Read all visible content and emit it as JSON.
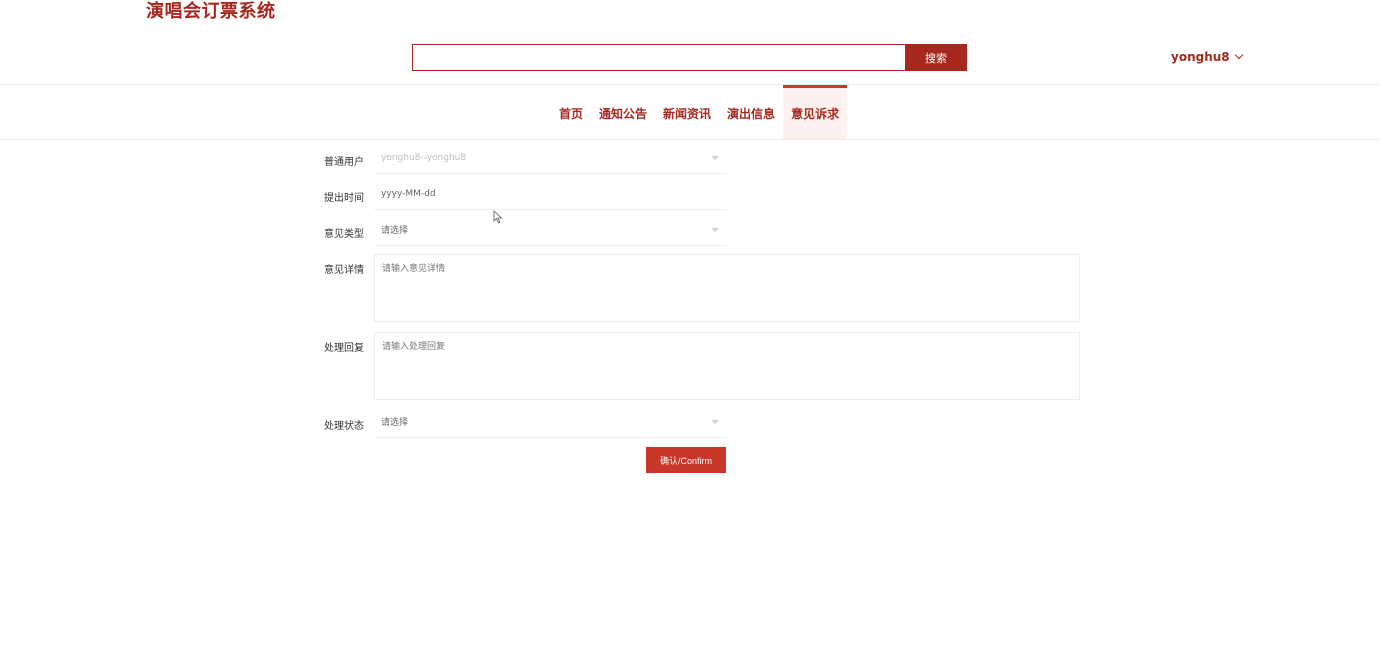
{
  "brand": "演唱会订票系统",
  "search": {
    "value": "",
    "button_label": "搜索"
  },
  "user": {
    "name": "yonghu8"
  },
  "nav": {
    "items": [
      "首页",
      "通知公告",
      "新闻资讯",
      "演出信息",
      "意见诉求"
    ],
    "active_index": 4
  },
  "form": {
    "user_label": "普通用户",
    "user_value": "yonghu8--yonghu8",
    "time_label": "提出时间",
    "time_placeholder": "yyyy-MM-dd",
    "type_label": "意见类型",
    "type_value": "请选择",
    "detail_label": "意见详情",
    "detail_placeholder": "请输入意见详情",
    "reply_label": "处理回复",
    "reply_placeholder": "请输入处理回复",
    "status_label": "处理状态",
    "status_value": "请选择",
    "confirm_label": "确认/Confirm"
  },
  "colors": {
    "brand": "#a6281f",
    "accent": "#c8372a"
  }
}
